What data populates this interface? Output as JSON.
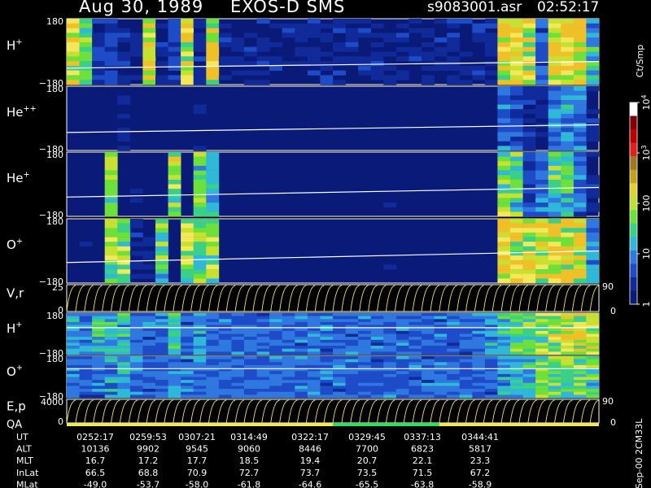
{
  "header": {
    "date": "Aug 30, 1989",
    "instrument": "EXOS-D SMS",
    "file": "s9083001.asr",
    "time": "02:52:17"
  },
  "colors": {
    "background": "#000000",
    "spectrogram_bg": "#0a1a78",
    "trace": "#ffffff",
    "line_panel": "#f2e85a",
    "qa_yellow": "#f2e85a",
    "qa_green": "#2ee05a"
  },
  "panels": [
    {
      "id": "h-plus",
      "label": "H",
      "sup": "+",
      "ytop": "180",
      "ybot": "−180",
      "kind": "spectrogram",
      "activity": [
        0.85,
        0.6,
        0.15,
        0.15,
        0.1,
        0.1,
        0.9,
        0.1,
        0.15,
        0.9,
        0.1,
        0.9,
        0.1,
        0.1,
        0.1,
        0.1,
        0.1,
        0.1,
        0.1,
        0.1,
        0.1,
        0.1,
        0.1,
        0.1,
        0.1,
        0.1,
        0.1,
        0.1,
        0.1,
        0.1,
        0.1,
        0.1,
        0.1,
        0.1,
        0.95,
        0.9,
        0.85,
        0.3,
        0.9,
        0.95,
        0.95,
        0.5
      ],
      "trace": [
        0.75,
        0.65
      ]
    },
    {
      "id": "he-plus-plus",
      "label": "He",
      "sup": "++",
      "ytop": "180",
      "ybot": "−180",
      "kind": "spectrogram",
      "activity": [
        0.02,
        0.02,
        0.02,
        0.02,
        0.05,
        0.02,
        0.02,
        0.02,
        0.02,
        0.02,
        0.05,
        0.02,
        0.02,
        0.02,
        0.02,
        0.02,
        0.02,
        0.02,
        0.02,
        0.02,
        0.02,
        0.02,
        0.02,
        0.02,
        0.02,
        0.02,
        0.02,
        0.02,
        0.02,
        0.02,
        0.02,
        0.02,
        0.02,
        0.02,
        0.3,
        0.2,
        0.1,
        0.1,
        0.35,
        0.35,
        0.3,
        0.1
      ],
      "trace": [
        0.72,
        0.6
      ]
    },
    {
      "id": "he-plus",
      "label": "He",
      "sup": "+",
      "ytop": "180",
      "ybot": "−180",
      "kind": "spectrogram",
      "activity": [
        0.02,
        0.02,
        0.02,
        0.6,
        0.05,
        0.05,
        0.02,
        0.02,
        0.7,
        0.02,
        0.6,
        0.5,
        0.02,
        0.02,
        0.02,
        0.02,
        0.02,
        0.02,
        0.02,
        0.02,
        0.02,
        0.02,
        0.02,
        0.02,
        0.02,
        0.02,
        0.02,
        0.02,
        0.02,
        0.02,
        0.02,
        0.02,
        0.02,
        0.02,
        0.7,
        0.6,
        0.2,
        0.3,
        0.6,
        0.5,
        0.3,
        0.1
      ],
      "trace": [
        0.7,
        0.55
      ]
    },
    {
      "id": "o-plus",
      "label": "O",
      "sup": "+",
      "ytop": "180",
      "ybot": "−180",
      "kind": "spectrogram",
      "activity": [
        0.02,
        0.02,
        0.02,
        0.7,
        0.7,
        0.1,
        0.1,
        0.6,
        0.02,
        0.8,
        0.7,
        0.7,
        0.02,
        0.02,
        0.02,
        0.02,
        0.02,
        0.02,
        0.02,
        0.02,
        0.02,
        0.02,
        0.02,
        0.02,
        0.02,
        0.02,
        0.02,
        0.02,
        0.02,
        0.02,
        0.02,
        0.02,
        0.02,
        0.02,
        0.95,
        0.9,
        0.85,
        0.8,
        0.85,
        0.9,
        0.9,
        0.4
      ],
      "trace": [
        0.68,
        0.5
      ]
    },
    {
      "id": "v-r",
      "label": "V,r",
      "sup": "",
      "ytop": "25",
      "ybot": "0",
      "right_top": "90",
      "right_bot": "0",
      "kind": "lines"
    },
    {
      "id": "h-plus-2",
      "label": "H",
      "sup": "+",
      "ytop": "180",
      "ybot": "−180",
      "kind": "spectrogram",
      "activity": [
        0.4,
        0.35,
        0.5,
        0.5,
        0.5,
        0.3,
        0.3,
        0.3,
        0.5,
        0.3,
        0.4,
        0.3,
        0.3,
        0.3,
        0.3,
        0.3,
        0.3,
        0.3,
        0.3,
        0.3,
        0.3,
        0.3,
        0.3,
        0.3,
        0.3,
        0.3,
        0.3,
        0.3,
        0.3,
        0.3,
        0.3,
        0.3,
        0.3,
        0.4,
        0.55,
        0.6,
        0.6,
        0.7,
        0.75,
        0.8,
        0.8,
        0.8
      ],
      "trace": [
        0.35,
        0.35
      ]
    },
    {
      "id": "o-plus-2",
      "label": "O",
      "sup": "+",
      "ytop": "180",
      "ybot": "−180",
      "kind": "spectrogram",
      "activity": [
        0.3,
        0.3,
        0.3,
        0.4,
        0.5,
        0.3,
        0.3,
        0.3,
        0.4,
        0.3,
        0.3,
        0.3,
        0.3,
        0.3,
        0.3,
        0.3,
        0.3,
        0.3,
        0.3,
        0.3,
        0.3,
        0.3,
        0.3,
        0.3,
        0.3,
        0.3,
        0.3,
        0.3,
        0.3,
        0.3,
        0.3,
        0.3,
        0.3,
        0.3,
        0.4,
        0.5,
        0.5,
        0.6,
        0.6,
        0.65,
        0.65,
        0.6
      ],
      "trace": [
        0.3,
        0.3
      ]
    },
    {
      "id": "e-p",
      "label": "E,p",
      "sup": "",
      "ytop": "4000",
      "ybot": "0",
      "right_top": "90",
      "right_bot": "0",
      "kind": "lines"
    }
  ],
  "qa": {
    "label": "QA"
  },
  "colorbar": {
    "title": "Ct/Smp",
    "ticks": [
      {
        "t": "10",
        "sup": "4",
        "v": 4
      },
      {
        "t": "10",
        "sup": "3",
        "v": 3
      },
      {
        "t": "100",
        "sup": "",
        "v": 2
      },
      {
        "t": "10",
        "sup": "",
        "v": 1
      },
      {
        "t": "1",
        "sup": "",
        "v": 0
      }
    ]
  },
  "footer": {
    "side_label": "Sep-00  2CM33L",
    "rows": [
      {
        "label": "UT",
        "values": [
          "0252:17",
          "0259:53",
          "0307:21",
          "0314:49",
          "0322:17",
          "0329:45",
          "0337:13",
          "0344:41"
        ]
      },
      {
        "label": "ALT",
        "values": [
          "10136",
          "9902",
          "9545",
          "9060",
          "8446",
          "7700",
          "6823",
          "5817"
        ]
      },
      {
        "label": "MLT",
        "values": [
          "16.7",
          "17.2",
          "17.7",
          "18.5",
          "19.4",
          "20.7",
          "22.1",
          "23.3"
        ]
      },
      {
        "label": "InLat",
        "values": [
          "66.5",
          "68.8",
          "70.9",
          "72.7",
          "73.7",
          "73.5",
          "71.5",
          "67.2"
        ]
      },
      {
        "label": "MLat",
        "values": [
          "-49.0",
          "-53.7",
          "-58.0",
          "-61.8",
          "-64.6",
          "-65.5",
          "-63.8",
          "-58.9"
        ]
      }
    ]
  },
  "chart_data": {
    "type": "heatmap",
    "title": "Aug 30, 1989   EXOS-D SMS",
    "panels": [
      "H+",
      "He++",
      "He+",
      "O+",
      "V,r",
      "H+",
      "O+",
      "E,p"
    ],
    "colorbar_label": "Ct/Smp",
    "colorbar_range": [
      1,
      10000
    ],
    "x": [
      "0252:17",
      "0259:53",
      "0307:21",
      "0314:49",
      "0322:17",
      "0329:45",
      "0337:13",
      "0344:41"
    ]
  }
}
